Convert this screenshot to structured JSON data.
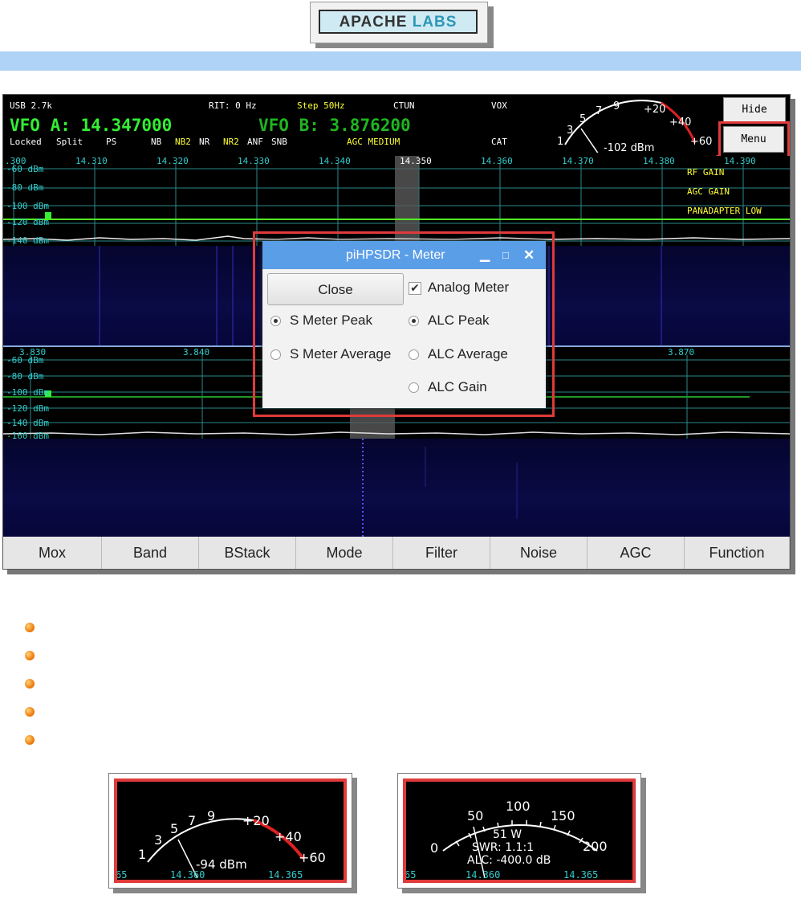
{
  "logo": {
    "part1": "APACHE",
    "part2": "LABS"
  },
  "header": {
    "mode": "USB 2.7k",
    "rit": "RIT: 0 Hz",
    "step": "Step 50Hz",
    "ctun": "CTUN",
    "vox": "VOX",
    "vfo_a_label": "VFO A:",
    "vfo_a_value": "14.347000",
    "vfo_b_label": "VFO B:",
    "vfo_b_value": "3.876200",
    "locked": "Locked",
    "split": "Split",
    "ps": "PS",
    "nb": "NB",
    "nb2": "NB2",
    "nr": "NR",
    "nr2": "NR2",
    "anf": "ANF",
    "snb": "SNB",
    "agc": "AGC MEDIUM",
    "cat": "CAT"
  },
  "top_meter": {
    "ticks": [
      "1",
      "3",
      "5",
      "7",
      "9",
      "+20",
      "+40",
      "+60"
    ],
    "reading": "-102 dBm"
  },
  "side_buttons": {
    "hide": "Hide",
    "menu": "Menu"
  },
  "side_labels": [
    "RF GAIN",
    "AGC GAIN",
    "PANADAPTER LOW"
  ],
  "pan1": {
    "freqs": [
      ".300",
      "14.310",
      "14.320",
      "14.330",
      "14.340",
      "14.350",
      "14.360",
      "14.370",
      "14.380",
      "14.390"
    ],
    "levels": [
      "-60 dBm",
      "-80 dBm",
      "-100 dBm",
      "-120 dBm",
      "-140 dBm"
    ]
  },
  "pan2": {
    "freqs": [
      "3.830",
      "3.840",
      "3.870"
    ],
    "levels": [
      "-60 dBm",
      "-80 dBm",
      "-100 dBm",
      "-120 dBm",
      "-140 dBm",
      "-160 dBm"
    ]
  },
  "dialog": {
    "title": "piHPSDR - Meter",
    "close": "Close",
    "analog_meter": "Analog Meter",
    "s_meter_peak": "S Meter Peak",
    "alc_peak": "ALC Peak",
    "s_meter_average": "S Meter Average",
    "alc_average": "ALC Average",
    "alc_gain": "ALC Gain"
  },
  "bottom_buttons": [
    "Mox",
    "Band",
    "BStack",
    "Mode",
    "Filter",
    "Noise",
    "AGC",
    "Function"
  ],
  "rx_meter": {
    "ticks": [
      "1",
      "3",
      "5",
      "7",
      "9",
      "+20",
      "+40",
      "+60"
    ],
    "reading": "-94 dBm",
    "freqs": [
      "65",
      "14.360",
      "14.365"
    ]
  },
  "tx_meter": {
    "ticks": [
      "0",
      "50",
      "100",
      "150",
      "200"
    ],
    "power": "51 W",
    "swr": "SWR: 1.1:1",
    "alc": "ALC: -400.0 dB",
    "freqs": [
      "65",
      "14.360",
      "14.365"
    ]
  }
}
